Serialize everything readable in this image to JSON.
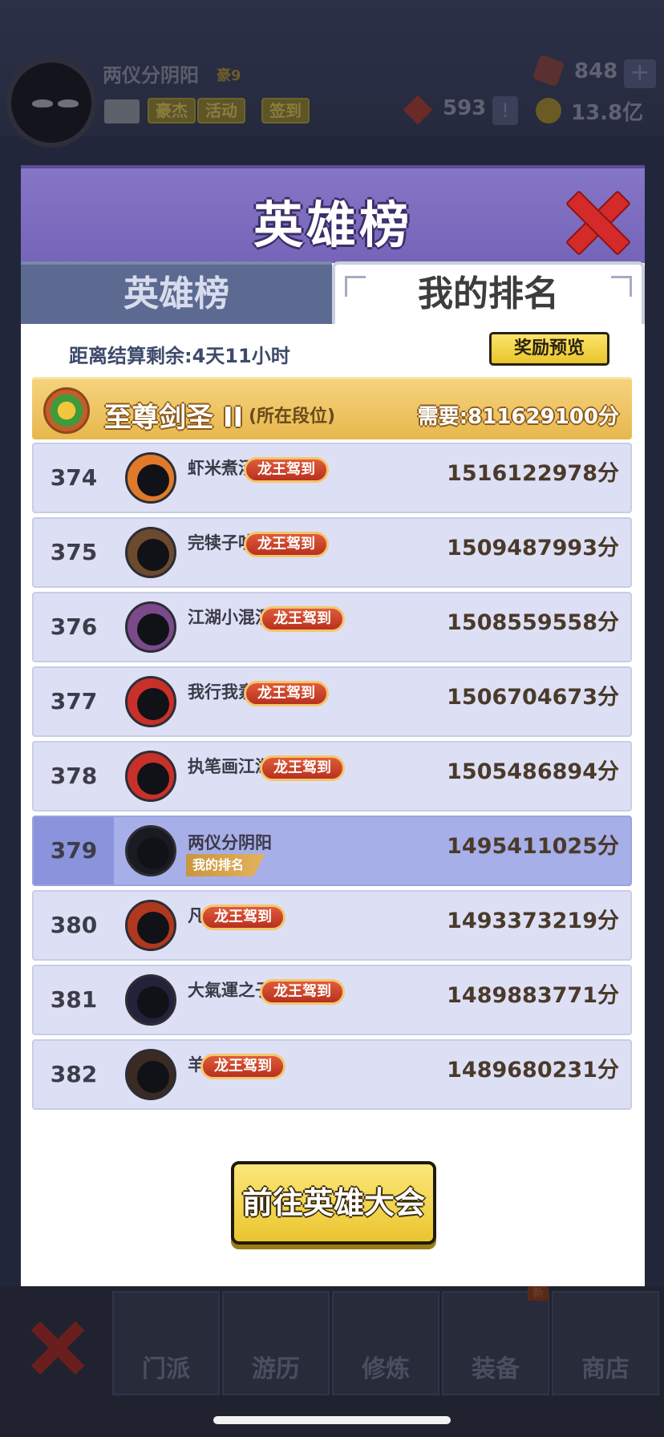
{
  "background": {
    "player_name": "两仪分阴阳",
    "vip": "豪9",
    "buttons": [
      "豪杰",
      "活动",
      "签到"
    ],
    "gems": "848",
    "tokens": "593",
    "coins": "13.8亿",
    "bottom_tabs": [
      "门派",
      "游历",
      "修炼",
      "装备",
      "商店"
    ],
    "new_badge": "新"
  },
  "modal": {
    "title": "英雄榜",
    "tabs": [
      {
        "label": "英雄榜",
        "active": false
      },
      {
        "label": "我的排名",
        "active": true
      }
    ],
    "countdown": "距离结算剩余:4天11小时",
    "reward_button": "奖励预览",
    "tier": {
      "name": "至尊剑圣 II",
      "note": "(所在段位)",
      "requirement": "需要:811629100分"
    },
    "my_rank_tag": "我的排名",
    "go_button": "前往英雄大会",
    "rows": [
      {
        "rank": "374",
        "name": "虾米煮汤",
        "badge": "龙王驾到",
        "score": "1516122978分",
        "avatar_color": "#e07a2a"
      },
      {
        "rank": "375",
        "name": "完犊子叻",
        "badge": "龙王驾到",
        "score": "1509487993分",
        "avatar_color": "#6b4a2e"
      },
      {
        "rank": "376",
        "name": "江湖小混混",
        "badge": "龙王驾到",
        "score": "1508559558分",
        "avatar_color": "#7a4a8a"
      },
      {
        "rank": "377",
        "name": "我行我素",
        "badge": "龙王驾到",
        "score": "1506704673分",
        "avatar_color": "#c8302a"
      },
      {
        "rank": "378",
        "name": "执笔画江湖",
        "badge": "龙王驾到",
        "score": "1505486894分",
        "avatar_color": "#c8302a"
      },
      {
        "rank": "379",
        "name": "两仪分阴阳",
        "badge": "",
        "score": "1495411025分",
        "avatar_color": "#1a1a22",
        "mine": true
      },
      {
        "rank": "380",
        "name": "凡",
        "badge": "龙王驾到",
        "score": "1493373219分",
        "avatar_color": "#b0381e"
      },
      {
        "rank": "381",
        "name": "大氣運之子",
        "badge": "龙王驾到",
        "score": "1489883771分",
        "avatar_color": "#22223a"
      },
      {
        "rank": "382",
        "name": "羊",
        "badge": "龙王驾到",
        "score": "1489680231分",
        "avatar_color": "#3a2a22"
      }
    ]
  }
}
